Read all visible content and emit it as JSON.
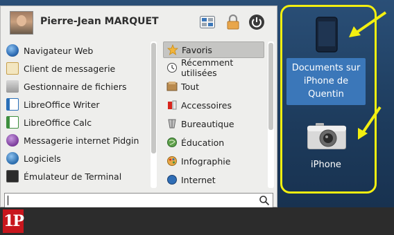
{
  "user": {
    "name": "Pierre-Jean MARQUET"
  },
  "header_icons": [
    "settings-icon",
    "lock-icon",
    "power-icon"
  ],
  "apps": [
    {
      "label": "Navigateur Web",
      "icon": "web-browser-icon",
      "color": "#2f6db5"
    },
    {
      "label": "Client de messagerie",
      "icon": "mail-client-icon",
      "color": "#d9b35a"
    },
    {
      "label": "Gestionnaire de fichiers",
      "icon": "file-manager-icon",
      "color": "#9a9a9a"
    },
    {
      "label": "LibreOffice Writer",
      "icon": "libreoffice-writer-icon",
      "color": "#2a6fb8"
    },
    {
      "label": "LibreOffice Calc",
      "icon": "libreoffice-calc-icon",
      "color": "#3e8f3e"
    },
    {
      "label": "Messagerie internet Pidgin",
      "icon": "pidgin-icon",
      "color": "#7a3a9a"
    },
    {
      "label": "Logiciels",
      "icon": "software-icon",
      "color": "#2e6fae"
    },
    {
      "label": "Émulateur de Terminal",
      "icon": "terminal-icon",
      "color": "#2b2b2b"
    }
  ],
  "categories": [
    {
      "label": "Favoris",
      "icon": "star-icon",
      "active": true
    },
    {
      "label": "Récemment utilisées",
      "icon": "history-icon",
      "active": false
    },
    {
      "label": "Tout",
      "icon": "all-apps-icon",
      "active": false
    },
    {
      "label": "Accessoires",
      "icon": "accessories-icon",
      "active": false
    },
    {
      "label": "Bureautique",
      "icon": "office-icon",
      "active": false
    },
    {
      "label": "Éducation",
      "icon": "education-icon",
      "active": false
    },
    {
      "label": "Infographie",
      "icon": "graphics-icon",
      "active": false
    },
    {
      "label": "Internet",
      "icon": "internet-icon",
      "active": false
    }
  ],
  "search": {
    "value": "",
    "placeholder": ""
  },
  "desktop": {
    "icons": [
      {
        "label": "Documents sur iPhone de Quentin",
        "lines": [
          "Documents sur",
          "iPhone de",
          "Quentin"
        ],
        "icon": "iphone-device-icon",
        "selected": true
      },
      {
        "label": "iPhone",
        "lines": [
          "iPhone"
        ],
        "icon": "camera-icon",
        "selected": false
      }
    ]
  },
  "colors": {
    "highlight": "#f3ef10",
    "selection": "#3b77b9",
    "taskbar_logo": "#c8161d"
  },
  "taskbar": {
    "logo_text": "1P"
  }
}
